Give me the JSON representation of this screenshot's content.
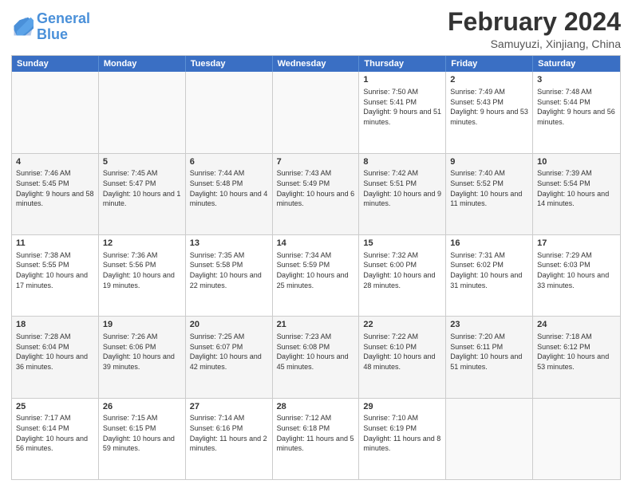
{
  "header": {
    "logo_general": "General",
    "logo_blue": "Blue",
    "month_title": "February 2024",
    "location": "Samuyuzi, Xinjiang, China"
  },
  "weekdays": [
    "Sunday",
    "Monday",
    "Tuesday",
    "Wednesday",
    "Thursday",
    "Friday",
    "Saturday"
  ],
  "rows": [
    [
      {
        "day": "",
        "info": ""
      },
      {
        "day": "",
        "info": ""
      },
      {
        "day": "",
        "info": ""
      },
      {
        "day": "",
        "info": ""
      },
      {
        "day": "1",
        "info": "Sunrise: 7:50 AM\nSunset: 5:41 PM\nDaylight: 9 hours and 51 minutes."
      },
      {
        "day": "2",
        "info": "Sunrise: 7:49 AM\nSunset: 5:43 PM\nDaylight: 9 hours and 53 minutes."
      },
      {
        "day": "3",
        "info": "Sunrise: 7:48 AM\nSunset: 5:44 PM\nDaylight: 9 hours and 56 minutes."
      }
    ],
    [
      {
        "day": "4",
        "info": "Sunrise: 7:46 AM\nSunset: 5:45 PM\nDaylight: 9 hours and 58 minutes."
      },
      {
        "day": "5",
        "info": "Sunrise: 7:45 AM\nSunset: 5:47 PM\nDaylight: 10 hours and 1 minute."
      },
      {
        "day": "6",
        "info": "Sunrise: 7:44 AM\nSunset: 5:48 PM\nDaylight: 10 hours and 4 minutes."
      },
      {
        "day": "7",
        "info": "Sunrise: 7:43 AM\nSunset: 5:49 PM\nDaylight: 10 hours and 6 minutes."
      },
      {
        "day": "8",
        "info": "Sunrise: 7:42 AM\nSunset: 5:51 PM\nDaylight: 10 hours and 9 minutes."
      },
      {
        "day": "9",
        "info": "Sunrise: 7:40 AM\nSunset: 5:52 PM\nDaylight: 10 hours and 11 minutes."
      },
      {
        "day": "10",
        "info": "Sunrise: 7:39 AM\nSunset: 5:54 PM\nDaylight: 10 hours and 14 minutes."
      }
    ],
    [
      {
        "day": "11",
        "info": "Sunrise: 7:38 AM\nSunset: 5:55 PM\nDaylight: 10 hours and 17 minutes."
      },
      {
        "day": "12",
        "info": "Sunrise: 7:36 AM\nSunset: 5:56 PM\nDaylight: 10 hours and 19 minutes."
      },
      {
        "day": "13",
        "info": "Sunrise: 7:35 AM\nSunset: 5:58 PM\nDaylight: 10 hours and 22 minutes."
      },
      {
        "day": "14",
        "info": "Sunrise: 7:34 AM\nSunset: 5:59 PM\nDaylight: 10 hours and 25 minutes."
      },
      {
        "day": "15",
        "info": "Sunrise: 7:32 AM\nSunset: 6:00 PM\nDaylight: 10 hours and 28 minutes."
      },
      {
        "day": "16",
        "info": "Sunrise: 7:31 AM\nSunset: 6:02 PM\nDaylight: 10 hours and 31 minutes."
      },
      {
        "day": "17",
        "info": "Sunrise: 7:29 AM\nSunset: 6:03 PM\nDaylight: 10 hours and 33 minutes."
      }
    ],
    [
      {
        "day": "18",
        "info": "Sunrise: 7:28 AM\nSunset: 6:04 PM\nDaylight: 10 hours and 36 minutes."
      },
      {
        "day": "19",
        "info": "Sunrise: 7:26 AM\nSunset: 6:06 PM\nDaylight: 10 hours and 39 minutes."
      },
      {
        "day": "20",
        "info": "Sunrise: 7:25 AM\nSunset: 6:07 PM\nDaylight: 10 hours and 42 minutes."
      },
      {
        "day": "21",
        "info": "Sunrise: 7:23 AM\nSunset: 6:08 PM\nDaylight: 10 hours and 45 minutes."
      },
      {
        "day": "22",
        "info": "Sunrise: 7:22 AM\nSunset: 6:10 PM\nDaylight: 10 hours and 48 minutes."
      },
      {
        "day": "23",
        "info": "Sunrise: 7:20 AM\nSunset: 6:11 PM\nDaylight: 10 hours and 51 minutes."
      },
      {
        "day": "24",
        "info": "Sunrise: 7:18 AM\nSunset: 6:12 PM\nDaylight: 10 hours and 53 minutes."
      }
    ],
    [
      {
        "day": "25",
        "info": "Sunrise: 7:17 AM\nSunset: 6:14 PM\nDaylight: 10 hours and 56 minutes."
      },
      {
        "day": "26",
        "info": "Sunrise: 7:15 AM\nSunset: 6:15 PM\nDaylight: 10 hours and 59 minutes."
      },
      {
        "day": "27",
        "info": "Sunrise: 7:14 AM\nSunset: 6:16 PM\nDaylight: 11 hours and 2 minutes."
      },
      {
        "day": "28",
        "info": "Sunrise: 7:12 AM\nSunset: 6:18 PM\nDaylight: 11 hours and 5 minutes."
      },
      {
        "day": "29",
        "info": "Sunrise: 7:10 AM\nSunset: 6:19 PM\nDaylight: 11 hours and 8 minutes."
      },
      {
        "day": "",
        "info": ""
      },
      {
        "day": "",
        "info": ""
      }
    ]
  ]
}
